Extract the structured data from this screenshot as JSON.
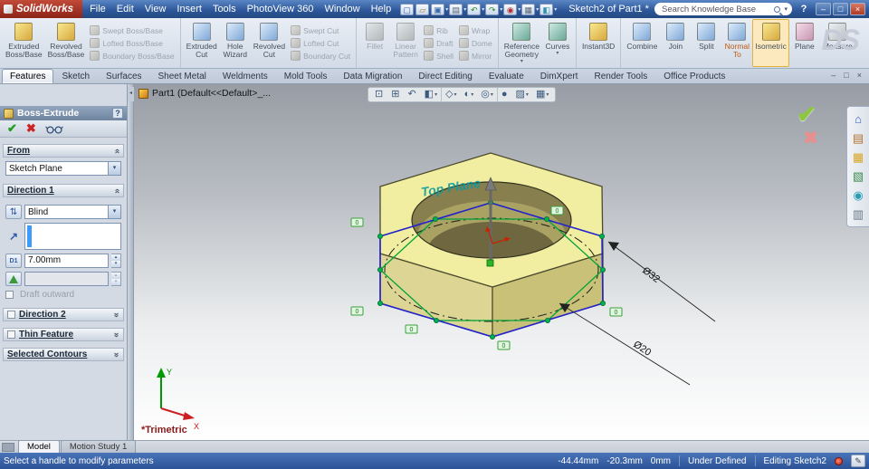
{
  "glyphs": {
    "dropdown": "▾",
    "spin_up": "▴",
    "spin_down": "▾",
    "chevron": "«",
    "check": "✔",
    "cross": "✖",
    "help": "?",
    "min": "–",
    "restore": "□",
    "close": "×",
    "pencil": "✎",
    "reverse": "⇅",
    "dir_arrow": "↗",
    "collapse": "◂"
  },
  "branding": {
    "ds": "DS"
  },
  "titlebar": {
    "logo": "SolidWorks",
    "menus": [
      "File",
      "Edit",
      "View",
      "Insert",
      "Tools",
      "PhotoView 360",
      "Window",
      "Help"
    ],
    "doc_title": "Sketch2 of Part1 *",
    "search_value": "Search Knowledge Base"
  },
  "quick_toolbar": [
    {
      "name": "new-button",
      "glyph": "▢",
      "cls": "c-blue"
    },
    {
      "name": "open-button",
      "glyph": "▱",
      "cls": "c-gold"
    },
    {
      "name": "save-button",
      "glyph": "▣",
      "cls": "c-blue",
      "arrow": "▾"
    },
    {
      "name": "print-button",
      "glyph": "▤",
      "cls": "c-gray",
      "arrow": "▾"
    },
    {
      "name": "undo-button",
      "glyph": "↶",
      "cls": "c-green",
      "arrow": "▾"
    },
    {
      "name": "redo-button",
      "glyph": "↷",
      "cls": "c-green",
      "arrow": "▾"
    },
    {
      "name": "rebuild-button",
      "glyph": "◉",
      "cls": "c-red",
      "arrow": "▾"
    },
    {
      "name": "options-button",
      "glyph": "▦",
      "cls": "c-gray",
      "arrow": "▾"
    },
    {
      "name": "edit-color-button",
      "glyph": "◧",
      "cls": "c-teal",
      "arrow": "▾"
    }
  ],
  "ribbon": {
    "boss_big": [
      {
        "name": "extruded-boss-base-button",
        "l1": "Extruded",
        "l2": "Boss/Base",
        "cls": "g-gold"
      },
      {
        "name": "revolved-boss-base-button",
        "l1": "Revolved",
        "l2": "Boss/Base",
        "cls": "g-gold"
      }
    ],
    "boss_small": [
      {
        "name": "swept-boss-base-button",
        "label": "Swept Boss/Base",
        "cls": "dis"
      },
      {
        "name": "lofted-boss-base-button",
        "label": "Lofted Boss/Base",
        "cls": "dis"
      },
      {
        "name": "boundary-boss-base-button",
        "label": "Boundary Boss/Base",
        "cls": "dis"
      }
    ],
    "cut_big": [
      {
        "name": "extruded-cut-button",
        "l1": "Extruded",
        "l2": "Cut",
        "cls": "g-blue"
      },
      {
        "name": "hole-wizard-button",
        "l1": "Hole",
        "l2": "Wizard",
        "cls": "g-blue"
      },
      {
        "name": "revolved-cut-button",
        "l1": "Revolved",
        "l2": "Cut",
        "cls": "g-blue"
      }
    ],
    "cut_small": [
      {
        "name": "swept-cut-button",
        "label": "Swept Cut",
        "cls": "dis"
      },
      {
        "name": "lofted-cut-button",
        "label": "Lofted Cut",
        "cls": "dis"
      },
      {
        "name": "boundary-cut-button",
        "label": "Boundary Cut",
        "cls": "dis"
      }
    ],
    "feat_big": [
      {
        "name": "fillet-button",
        "l1": "Fillet",
        "l2": "",
        "cls": "g-teal dis"
      },
      {
        "name": "linear-pattern-button",
        "l1": "Linear",
        "l2": "Pattern",
        "cls": "g-teal dis"
      }
    ],
    "feat_small1": [
      {
        "name": "rib-button",
        "label": "Rib",
        "cls": "dis"
      },
      {
        "name": "draft-feature-button",
        "label": "Draft",
        "cls": "dis"
      },
      {
        "name": "shell-button",
        "label": "Shell",
        "cls": "dis"
      }
    ],
    "feat_small2": [
      {
        "name": "wrap-button",
        "label": "Wrap",
        "cls": "dis"
      },
      {
        "name": "dome-button",
        "label": "Dome",
        "cls": "dis"
      },
      {
        "name": "mirror-button",
        "label": "Mirror",
        "cls": "dis"
      }
    ],
    "ref_big": [
      {
        "name": "reference-geometry-button",
        "l1": "Reference",
        "l2": "Geometry",
        "cls": "g-teal",
        "arrow": "▾"
      },
      {
        "name": "curves-button",
        "l1": "Curves",
        "l2": "",
        "cls": "g-teal",
        "arrow": "▾"
      }
    ],
    "inst_big": [
      {
        "name": "instant3d-button",
        "l1": "Instant3D",
        "l2": "",
        "cls": "g-gold"
      }
    ],
    "extra_big": [
      {
        "name": "combine-button",
        "l1": "Combine",
        "l2": "",
        "cls": "g-blue"
      },
      {
        "name": "join-button",
        "l1": "Join",
        "l2": "",
        "cls": "g-blue"
      },
      {
        "name": "split-button",
        "l1": "Split",
        "l2": "",
        "cls": "g-blue"
      },
      {
        "name": "normal-to-button",
        "l1": "Normal",
        "l2": "To",
        "cls": "g-blue hot"
      },
      {
        "name": "isometric-button",
        "l1": "Isometric",
        "l2": "",
        "cls": "g-gold sel"
      },
      {
        "name": "plane-button",
        "l1": "Plane",
        "l2": "",
        "cls": "g-pink"
      },
      {
        "name": "measure-button",
        "l1": "Measure",
        "l2": "",
        "cls": "g-gray"
      }
    ]
  },
  "tab_bar": [
    {
      "name": "tab-features",
      "label": "Features",
      "cls": "active"
    },
    {
      "name": "tab-sketch",
      "label": "Sketch"
    },
    {
      "name": "tab-surfaces",
      "label": "Surfaces"
    },
    {
      "name": "tab-sheet-metal",
      "label": "Sheet Metal"
    },
    {
      "name": "tab-weldments",
      "label": "Weldments"
    },
    {
      "name": "tab-mold-tools",
      "label": "Mold Tools"
    },
    {
      "name": "tab-data-migration",
      "label": "Data Migration"
    },
    {
      "name": "tab-direct-editing",
      "label": "Direct Editing"
    },
    {
      "name": "tab-evaluate",
      "label": "Evaluate"
    },
    {
      "name": "tab-dimxpert",
      "label": "DimXpert"
    },
    {
      "name": "tab-render-tools",
      "label": "Render Tools"
    },
    {
      "name": "tab-office-products",
      "label": "Office Products"
    }
  ],
  "property_manager": {
    "title": "Boss-Extrude",
    "from_label": "From",
    "from_value": "Sketch Plane",
    "dir1_label": "Direction 1",
    "dir1_condition": "Blind",
    "depth_icon": "D1",
    "depth_value": "7.00mm",
    "draft_outward_label": "Draft outward",
    "dir2_label": "Direction 2",
    "thin_label": "Thin Feature",
    "contours_label": "Selected Contours"
  },
  "headsup": [
    {
      "name": "zoom-fit-button",
      "g": "⊡"
    },
    {
      "name": "zoom-area-button",
      "g": "⊞"
    },
    {
      "name": "previous-view-button",
      "g": "↶"
    },
    {
      "name": "section-view-button",
      "g": "◧",
      "arrow": "▾"
    },
    {
      "name": "view-orientation-button",
      "g": "◇",
      "arrow": "▾",
      "cls": "sep"
    },
    {
      "name": "display-style-button",
      "g": "◐",
      "arrow": "▾"
    },
    {
      "name": "hide-show-items-button",
      "g": "◎",
      "arrow": "▾"
    },
    {
      "name": "edit-appearance-button",
      "g": "●",
      "cls": "sep"
    },
    {
      "name": "apply-scene-button",
      "g": "▨",
      "arrow": "▾"
    },
    {
      "name": "view-settings-button",
      "g": "▦",
      "arrow": "▾"
    }
  ],
  "viewport": {
    "tree_label": "Part1 (Default<<Default>_...",
    "plane_label": "Top Plane",
    "dim_hex": "Ø32",
    "dim_hole": "Ø20",
    "view_label": "*Trimetric",
    "badge": "0",
    "axis_x": "X",
    "axis_y": "Y"
  },
  "taskpane": [
    {
      "name": "solidworks-resources-tab",
      "glyph": "⌂",
      "cls": "tp1"
    },
    {
      "name": "design-library-tab",
      "glyph": "▤",
      "cls": "tp2"
    },
    {
      "name": "file-explorer-tab",
      "glyph": "▦",
      "cls": "tp3"
    },
    {
      "name": "view-palette-tab",
      "glyph": "▧",
      "cls": "tp4"
    },
    {
      "name": "appearances-tab",
      "glyph": "◉",
      "cls": "tp5"
    },
    {
      "name": "custom-properties-tab",
      "glyph": "▥",
      "cls": "tp6"
    }
  ],
  "bottom_tabs": [
    {
      "name": "model-tab",
      "label": "Model",
      "cls": "active"
    },
    {
      "name": "motion-study-tab",
      "label": "Motion Study 1"
    }
  ],
  "statusbar": {
    "message": "Select a handle to modify parameters",
    "x": "-44.44mm",
    "y": "-20.3mm",
    "z": "0mm",
    "state": "Under Defined",
    "mode": "Editing Sketch2"
  }
}
